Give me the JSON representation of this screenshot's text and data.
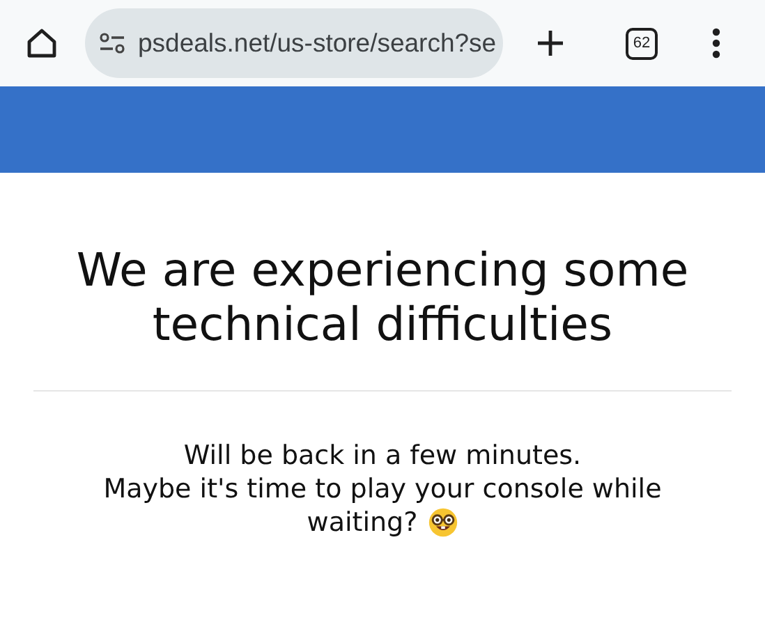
{
  "browser": {
    "url": "psdeals.net/us-store/search?se",
    "tab_count": "62"
  },
  "page": {
    "heading": "We are experiencing some technical difficulties",
    "message": [
      "Will be back in a few minutes.",
      "Maybe it's time to play your console while",
      "waiting?"
    ]
  }
}
